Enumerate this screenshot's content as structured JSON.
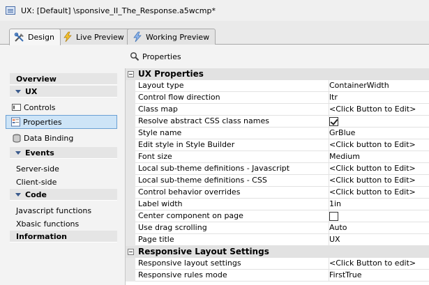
{
  "window": {
    "title": "UX: [Default] \\sponsive_II_The_Response.a5wcmp*"
  },
  "tabs": [
    {
      "label": "Design",
      "icon": "design-tools-icon",
      "active": true
    },
    {
      "label": "Live Preview",
      "icon": "lightning-icon",
      "active": false
    },
    {
      "label": "Working Preview",
      "icon": "lightning-icon",
      "active": false
    }
  ],
  "panel": {
    "title": "Properties",
    "icon": "search-icon"
  },
  "sidebar": {
    "overview": "Overview",
    "ux": {
      "label": "UX",
      "items": [
        {
          "label": "Controls",
          "icon": "controls-icon"
        },
        {
          "label": "Properties",
          "icon": "properties-icon",
          "selected": true
        },
        {
          "label": "Data Binding",
          "icon": "database-icon"
        }
      ]
    },
    "events": {
      "label": "Events",
      "items": [
        "Server-side",
        "Client-side"
      ]
    },
    "code": {
      "label": "Code",
      "items": [
        "Javascript functions",
        "Xbasic functions"
      ]
    },
    "information": "Information"
  },
  "grid": {
    "categories": [
      {
        "label": "UX Properties",
        "rows": [
          {
            "name": "Layout type",
            "value": "ContainerWidth"
          },
          {
            "name": "Control flow direction",
            "value": "ltr"
          },
          {
            "name": "Class map",
            "value": "<Click Button to Edit>"
          },
          {
            "name": "Resolve abstract CSS class names",
            "value": "",
            "checkbox": true,
            "checked": true
          },
          {
            "name": "Style name",
            "value": "GrBlue"
          },
          {
            "name": "Edit style in Style Builder",
            "value": "<Click button to Edit>"
          },
          {
            "name": "Font size",
            "value": "Medium"
          },
          {
            "name": "Local sub-theme definitions - Javascript",
            "value": "<Click button to Edit>"
          },
          {
            "name": "Local sub-theme definitions - CSS",
            "value": "<Click button to Edit>"
          },
          {
            "name": "Control behavior overrides",
            "value": "<Click button to Edit>"
          },
          {
            "name": "Label width",
            "value": "1in"
          },
          {
            "name": "Center component on page",
            "value": "",
            "checkbox": true,
            "checked": false
          },
          {
            "name": "Use drag scrolling",
            "value": "Auto"
          },
          {
            "name": "Page title",
            "value": "UX"
          }
        ]
      },
      {
        "label": "Responsive Layout Settings",
        "rows": [
          {
            "name": "Responsive layout settings",
            "value": "<Click Button to edit>"
          },
          {
            "name": "Responsive rules mode",
            "value": "FirstTrue"
          }
        ]
      }
    ]
  }
}
